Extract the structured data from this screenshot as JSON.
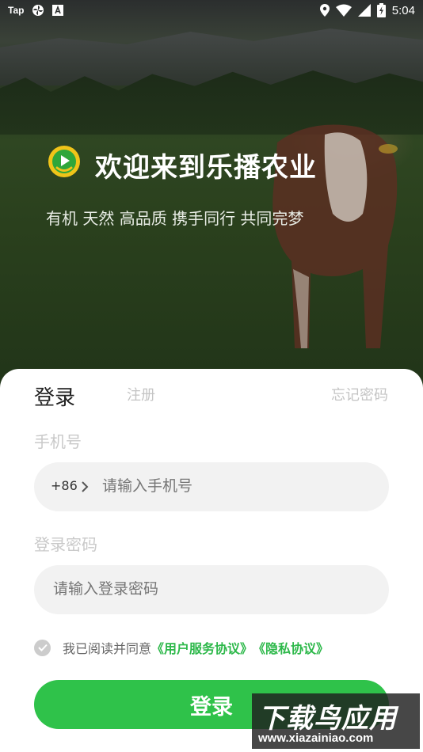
{
  "status_bar": {
    "left_app_label": "Tap",
    "time": "5:04"
  },
  "hero": {
    "title": "欢迎来到乐播农业",
    "subtitle": "有机 天然 高品质 携手同行 共同完梦",
    "logo_icon": "play-circle-logo-icon"
  },
  "panel": {
    "tab_login": "登录",
    "tab_register": "注册",
    "forgot_password": "忘记密码",
    "phone_label": "手机号",
    "country_code": "+86",
    "phone_placeholder": "请输入手机号",
    "password_label": "登录密码",
    "password_placeholder": "请输入登录密码",
    "agreement_prefix": "我已阅读并同意",
    "agreement_link_1": "《用户服务协议》",
    "agreement_link_2": "《隐私协议》",
    "login_button": "登录"
  },
  "watermark": {
    "title": "下载鸟应用",
    "url": "www.xiazainiao.com"
  },
  "colors": {
    "accent_green": "#2fc24a",
    "link_green": "#2db84a",
    "input_bg": "#f2f2f2"
  }
}
